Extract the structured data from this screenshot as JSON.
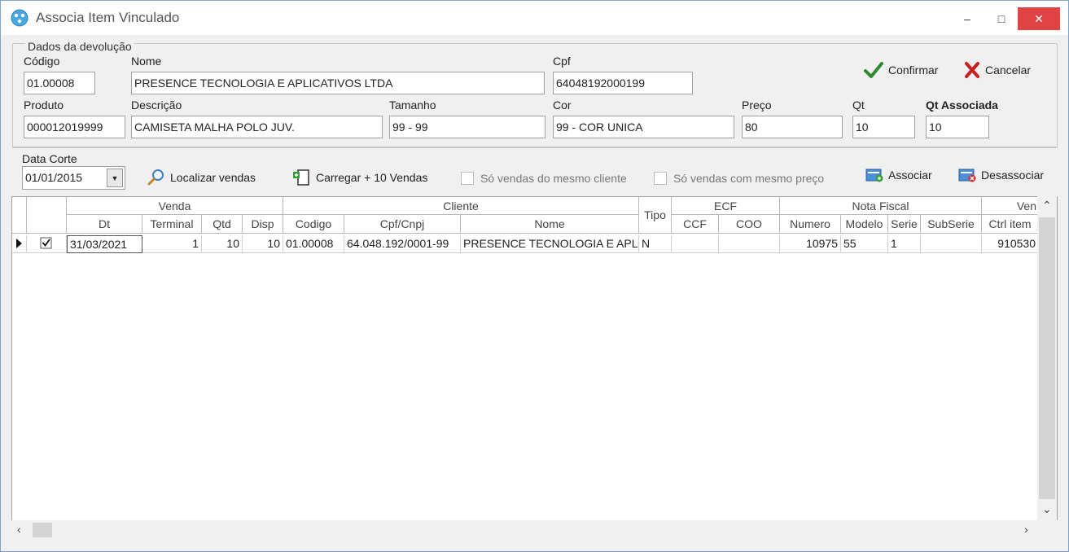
{
  "window": {
    "title": "Associa Item Vinculado",
    "minimize_label": "–",
    "maximize_label": "□",
    "close_label": "✕"
  },
  "dados": {
    "group_label": "Dados da devolução",
    "codigo_label": "Código",
    "codigo_value": "01.00008",
    "nome_label": "Nome",
    "nome_value": "PRESENCE TECNOLOGIA E APLICATIVOS LTDA",
    "cpf_label": "Cpf",
    "cpf_value": "64048192000199",
    "produto_label": "Produto",
    "produto_value": "000012019999",
    "descricao_label": "Descrição",
    "descricao_value": "CAMISETA MALHA POLO JUV.",
    "tamanho_label": "Tamanho",
    "tamanho_value": "99 - 99",
    "cor_label": "Cor",
    "cor_value": "99 - COR UNICA",
    "preco_label": "Preço",
    "preco_value": "80",
    "qt_label": "Qt",
    "qt_value": "10",
    "qt_associada_label": "Qt Associada",
    "qt_associada_value": "10"
  },
  "actions": {
    "confirmar": "Confirmar",
    "cancelar": "Cancelar",
    "localizar": "Localizar vendas",
    "carregar": "Carregar + 10 Vendas",
    "so_mesmo_cliente": "Só vendas do mesmo cliente",
    "so_mesmo_preco": "Só vendas com mesmo preço",
    "associar": "Associar",
    "desassociar": "Desassociar"
  },
  "filter": {
    "data_corte_label": "Data Corte",
    "data_corte_value": "01/01/2015"
  },
  "grid": {
    "group_headers": {
      "venda": "Venda",
      "cliente": "Cliente",
      "tipo": "Tipo",
      "ecf": "ECF",
      "nota_fiscal": "Nota Fiscal",
      "ven": "Ven"
    },
    "columns": {
      "dt": "Dt",
      "terminal": "Terminal",
      "qtd": "Qtd",
      "disp": "Disp",
      "codigo": "Codigo",
      "cpf_cnpj": "Cpf/Cnpj",
      "nome": "Nome",
      "ccf": "CCF",
      "coo": "COO",
      "numero": "Numero",
      "modelo": "Modelo",
      "serie": "Serie",
      "subserie": "SubSerie",
      "ctrl_item": "Ctrl item"
    },
    "row": {
      "checked": true,
      "dt": "31/03/2021",
      "terminal": "1",
      "qtd": "10",
      "disp": "10",
      "codigo": "01.00008",
      "cpf_cnpj": "64.048.192/0001-99",
      "nome": "PRESENCE TECNOLOGIA E APLICATIVOS LTDA",
      "tipo": "N",
      "ccf": "",
      "coo": "",
      "numero": "10975",
      "modelo": "55",
      "serie": "1",
      "subserie": "",
      "ctrl_item": "910530"
    }
  },
  "colors": {
    "close_button": "#e04343",
    "confirm_check": "#2e8b2e",
    "cancel_x": "#c62020"
  }
}
